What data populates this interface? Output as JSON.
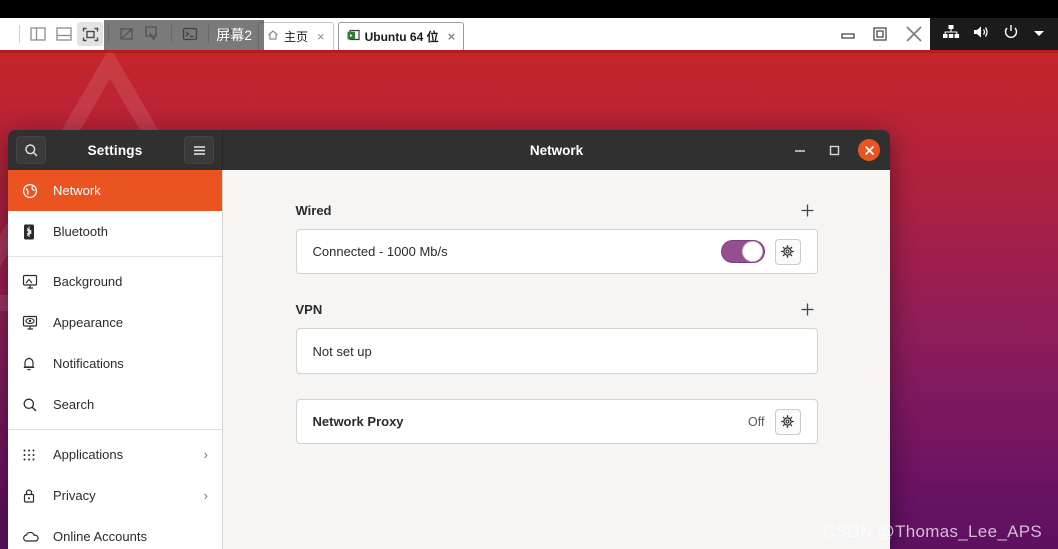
{
  "vmware": {
    "toolbar_buttons": [
      {
        "name": "sidebar-toggle-icon",
        "label": "Show/Hide Sidebar"
      },
      {
        "name": "console-view-icon",
        "label": "Console View"
      },
      {
        "name": "fullscreen-icon",
        "label": "Full Screen"
      },
      {
        "name": "snapshot-icon",
        "label": "Snapshot"
      },
      {
        "name": "revert-snapshot-icon",
        "label": "Revert Snapshot"
      },
      {
        "name": "terminal-icon",
        "label": "Console"
      },
      {
        "name": "unity-icon",
        "label": "Unity Mode"
      }
    ],
    "screen_overlay_label": "屏幕2",
    "tabs": [
      {
        "label": "主页",
        "icon": "home-icon",
        "selected": false,
        "close": "×"
      },
      {
        "label": "Ubuntu 64 位",
        "icon": "vm-icon",
        "selected": true,
        "close": "×"
      }
    ],
    "window_controls": {
      "minimize": "minimize-icon",
      "restore": "restore-icon",
      "close": "close-icon"
    },
    "tray_icons": [
      {
        "name": "network-tray-icon"
      },
      {
        "name": "volume-tray-icon"
      },
      {
        "name": "power-tray-icon"
      },
      {
        "name": "dropdown-arrow-icon"
      }
    ]
  },
  "settings_window": {
    "sidebar_header": {
      "search_icon": "search-icon",
      "title": "Settings",
      "menu_icon": "hamburger-menu-icon"
    },
    "title": "Network",
    "controls": {
      "minimize": "–",
      "maximize": "□",
      "close": "✕"
    },
    "sidebar": {
      "items": [
        {
          "label": "Network",
          "icon": "network-globe-icon",
          "active": true,
          "chevron": ""
        },
        {
          "label": "Bluetooth",
          "icon": "bluetooth-icon",
          "active": false,
          "chevron": ""
        },
        {
          "label": "Background",
          "icon": "background-monitor-icon",
          "active": false,
          "chevron": "",
          "sep_before": true
        },
        {
          "label": "Appearance",
          "icon": "appearance-icon",
          "active": false,
          "chevron": ""
        },
        {
          "label": "Notifications",
          "icon": "bell-icon",
          "active": false,
          "chevron": ""
        },
        {
          "label": "Search",
          "icon": "search-icon",
          "active": false,
          "chevron": ""
        },
        {
          "label": "Applications",
          "icon": "applications-grid-icon",
          "active": false,
          "chevron": "›",
          "sep_before": true
        },
        {
          "label": "Privacy",
          "icon": "lock-icon",
          "active": false,
          "chevron": "›"
        },
        {
          "label": "Online Accounts",
          "icon": "cloud-icon",
          "active": false,
          "chevron": ""
        }
      ]
    },
    "main": {
      "wired": {
        "section_title": "Wired",
        "add_label": "+",
        "status": "Connected - 1000 Mb/s",
        "toggle_on": true,
        "settings_icon": "gear-icon"
      },
      "vpn": {
        "section_title": "VPN",
        "add_label": "+",
        "status": "Not set up"
      },
      "proxy": {
        "title": "Network Proxy",
        "state": "Off",
        "settings_icon": "gear-icon"
      }
    }
  },
  "watermark": "CSDN @Thomas_Lee_APS",
  "colors": {
    "ubuntu_orange": "#e95420",
    "toggle_purple": "#934f8e",
    "titlebar_dark": "#303030",
    "content_bg": "#f6f5f4",
    "desktop_top": "#c5252a",
    "desktop_bottom": "#5e1060"
  }
}
